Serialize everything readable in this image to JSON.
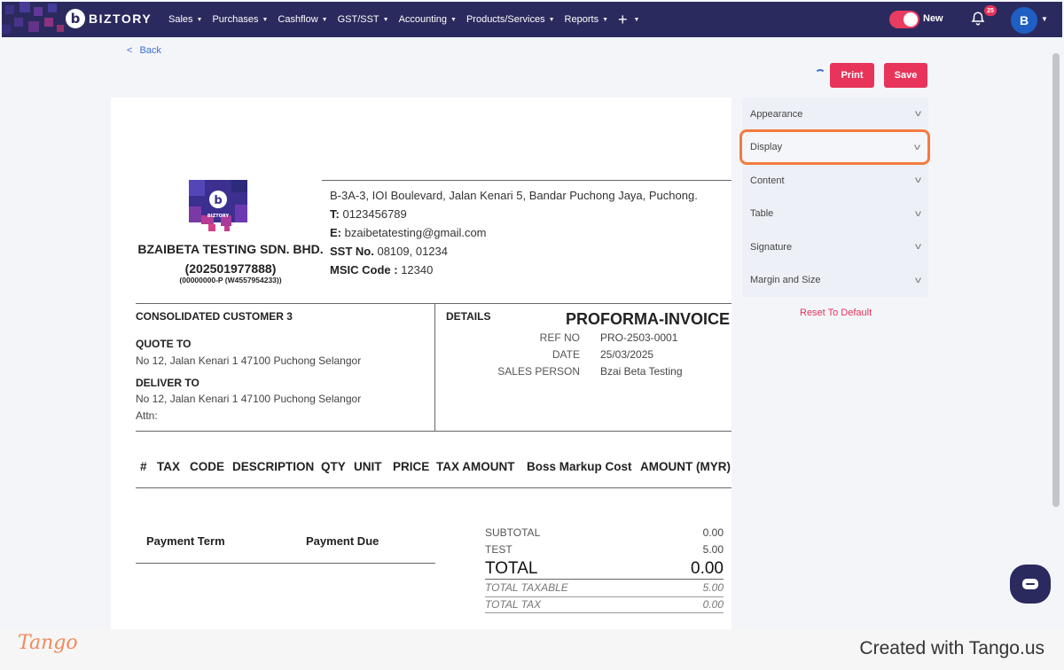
{
  "nav": {
    "brand": "BIZTORY",
    "brand_mark": "b",
    "menu": [
      {
        "label": "Sales"
      },
      {
        "label": "Purchases"
      },
      {
        "label": "Cashflow"
      },
      {
        "label": "GST/SST"
      },
      {
        "label": "Accounting"
      },
      {
        "label": "Products/Services"
      },
      {
        "label": "Reports"
      }
    ],
    "plus": "+",
    "toggle_label": "New",
    "notification_count": "25",
    "avatar_letter": "B",
    "colors": {
      "nav_bg": "#2b2a5e",
      "accent": "#e8335a"
    }
  },
  "back_label": "Back",
  "actions": {
    "print": "Print",
    "save": "Save"
  },
  "document": {
    "company_name": "BZAIBETA TESTING SDN. BHD.(202501977888)",
    "company_reg": "(00000000-P (W4557954233))",
    "logo_text": "BIZTORY",
    "address": "B-3A-3, IOI Boulevard, Jalan Kenari 5, Bandar Puchong Jaya, Puchong.",
    "phone_label": "T:",
    "phone": "0123456789",
    "email_label": "E:",
    "email": "bzaibetatesting@gmail.com",
    "sst_label": "SST No.",
    "sst": "08109, 01234",
    "msic_label": "MSIC Code :",
    "msic": "12340",
    "customer": "CONSOLIDATED CUSTOMER 3",
    "quote_to_label": "QUOTE TO",
    "quote_to": "No 12, Jalan Kenari 1 47100 Puchong Selangor",
    "deliver_to_label": "DELIVER TO",
    "deliver_to": "No 12, Jalan Kenari 1 47100 Puchong Selangor",
    "attn": "Attn:",
    "details_label": "DETAILS",
    "title": "PROFORMA-INVOICE",
    "ref_no_label": "REF NO",
    "ref_no": "PRO-2503-0001",
    "date_label": "DATE",
    "date": "25/03/2025",
    "sales_person_label": "SALES PERSON",
    "sales_person": "Bzai Beta Testing",
    "columns": [
      "#",
      "TAX",
      "CODE",
      "DESCRIPTION",
      "QTY",
      "UNIT",
      "PRICE",
      "TAX AMOUNT",
      "Boss Markup Cost",
      "AMOUNT (MYR)"
    ],
    "payment_term_label": "Payment Term",
    "payment_due_label": "Payment Due",
    "subtotal_label": "SUBTOTAL",
    "subtotal": "0.00",
    "test_label": "TEST",
    "test": "5.00",
    "total_label": "TOTAL",
    "total": "0.00",
    "total_taxable_label": "TOTAL TAXABLE",
    "total_taxable": "5.00",
    "total_tax_label": "TOTAL TAX",
    "total_tax": "0.00"
  },
  "panel": {
    "items": [
      {
        "label": "Appearance"
      },
      {
        "label": "Display"
      },
      {
        "label": "Content"
      },
      {
        "label": "Table"
      },
      {
        "label": "Signature"
      },
      {
        "label": "Margin and Size"
      }
    ],
    "reset": "Reset To Default"
  },
  "footer": {
    "tango": "Tango",
    "created": "Created with Tango.us"
  }
}
